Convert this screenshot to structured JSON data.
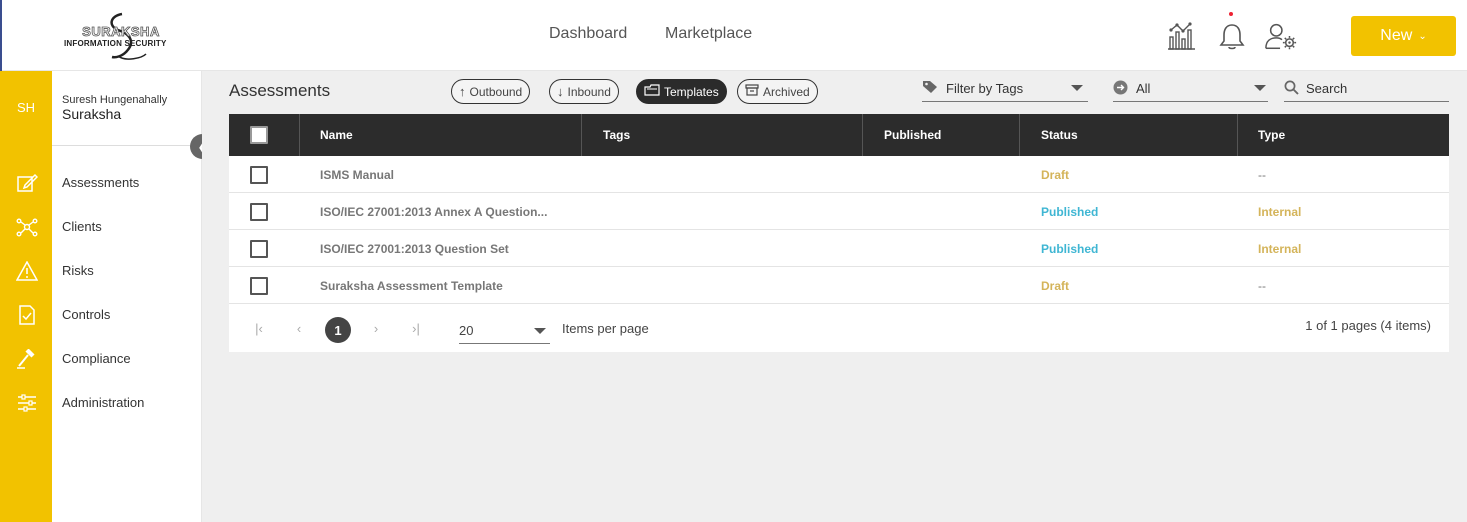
{
  "app": {
    "logo_text": "SURAKSHA",
    "logo_subtitle": "INFORMATION SECURITY"
  },
  "topnav": {
    "dashboard": "Dashboard",
    "marketplace": "Marketplace",
    "new_button": "New"
  },
  "icons": {
    "analytics": "analytics-chart-icon",
    "notifications": "bell-icon",
    "user_settings": "user-gear-icon"
  },
  "user": {
    "initials": "SH",
    "name": "Suresh Hungenahally",
    "org": "Suraksha"
  },
  "sidebar": {
    "items": [
      {
        "label": "Assessments",
        "icon": "edit-icon"
      },
      {
        "label": "Clients",
        "icon": "network-icon"
      },
      {
        "label": "Risks",
        "icon": "warning-icon"
      },
      {
        "label": "Controls",
        "icon": "checklist-icon"
      },
      {
        "label": "Compliance",
        "icon": "gavel-icon"
      },
      {
        "label": "Administration",
        "icon": "sliders-icon"
      }
    ]
  },
  "page": {
    "title": "Assessments",
    "tabs": [
      {
        "label": "Outbound",
        "active": false
      },
      {
        "label": "Inbound",
        "active": false
      },
      {
        "label": "Templates",
        "active": true
      },
      {
        "label": "Archived",
        "active": false
      }
    ],
    "filter_tags_placeholder": "Filter by Tags",
    "status_filter": "All",
    "search_placeholder": "Search"
  },
  "table": {
    "columns": [
      "Name",
      "Tags",
      "Published",
      "Status",
      "Type"
    ],
    "rows": [
      {
        "name": "ISMS Manual",
        "tags": "",
        "published": "",
        "status": "Draft",
        "type": "--"
      },
      {
        "name": "ISO/IEC 27001:2013 Annex A Question...",
        "tags": "",
        "published": "",
        "status": "Published",
        "type": "Internal"
      },
      {
        "name": "ISO/IEC 27001:2013 Question Set",
        "tags": "",
        "published": "",
        "status": "Published",
        "type": "Internal"
      },
      {
        "name": "Suraksha Assessment Template",
        "tags": "",
        "published": "",
        "status": "Draft",
        "type": "--"
      }
    ]
  },
  "pager": {
    "current_page": "1",
    "page_size": "20",
    "items_per_page_label": "Items per page",
    "summary": "1 of 1 pages (4 items)"
  },
  "colors": {
    "accent": "#f2c200",
    "header_dark": "#2c2c2c",
    "status_draft": "#d4b45a",
    "status_published": "#3fb6d3"
  }
}
